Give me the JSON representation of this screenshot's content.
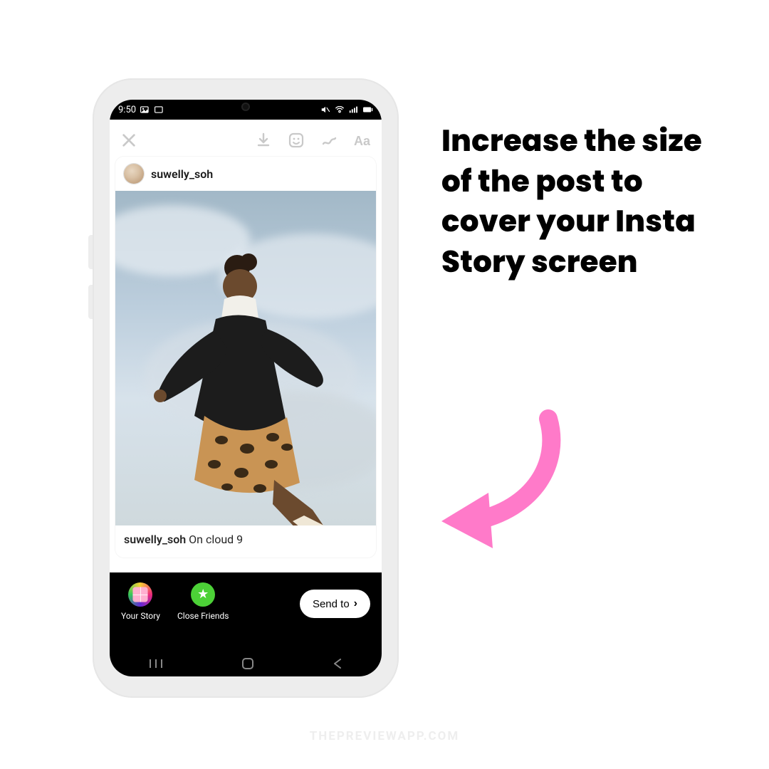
{
  "statusbar": {
    "time": "9:50"
  },
  "story_toolbar": {
    "icons": [
      "close-icon",
      "download-icon",
      "sticker-icon",
      "draw-icon",
      "text-icon"
    ]
  },
  "post": {
    "username": "suwelly_soh",
    "caption_username": "suwelly_soh",
    "caption_text": " On cloud 9"
  },
  "sharebar": {
    "your_story_label": "Your Story",
    "close_friends_label": "Close Friends",
    "send_to_label": "Send to"
  },
  "instruction": "Increase the size of the post to cover your Insta Story screen",
  "watermark": "THEPREVIEWAPP.COM",
  "colors": {
    "arrow": "#ff7ac9"
  }
}
